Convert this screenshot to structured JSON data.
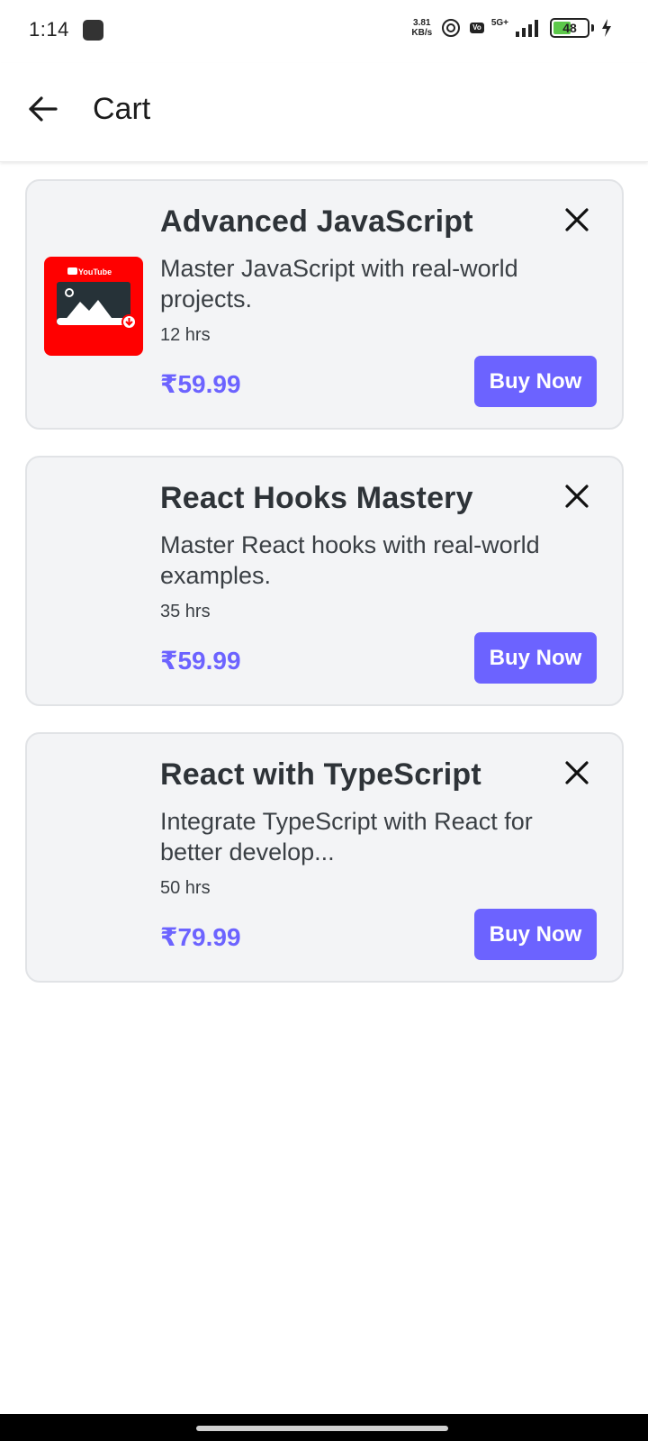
{
  "status_bar": {
    "time": "1:14",
    "net_speed_value": "3.81",
    "net_speed_unit": "KB/s",
    "network": "5G+",
    "battery": "48"
  },
  "header": {
    "title": "Cart"
  },
  "cart": {
    "items": [
      {
        "title": "Advanced JavaScript",
        "description": "Master JavaScript with real-world projects.",
        "hours": "12 hrs",
        "price": "₹59.99",
        "buy_label": "Buy Now",
        "thumbnail": "youtube-thumbnail"
      },
      {
        "title": "React Hooks Mastery",
        "description": "Master React hooks with real-world examples.",
        "hours": "35 hrs",
        "price": "₹59.99",
        "buy_label": "Buy Now"
      },
      {
        "title": "React with TypeScript",
        "description": "Integrate TypeScript with React for better develop...",
        "hours": "50 hrs",
        "price": "₹79.99",
        "buy_label": "Buy Now"
      }
    ]
  },
  "colors": {
    "accent": "#6c63ff",
    "card_bg": "#f3f4f6",
    "youtube_red": "#ff0000"
  }
}
